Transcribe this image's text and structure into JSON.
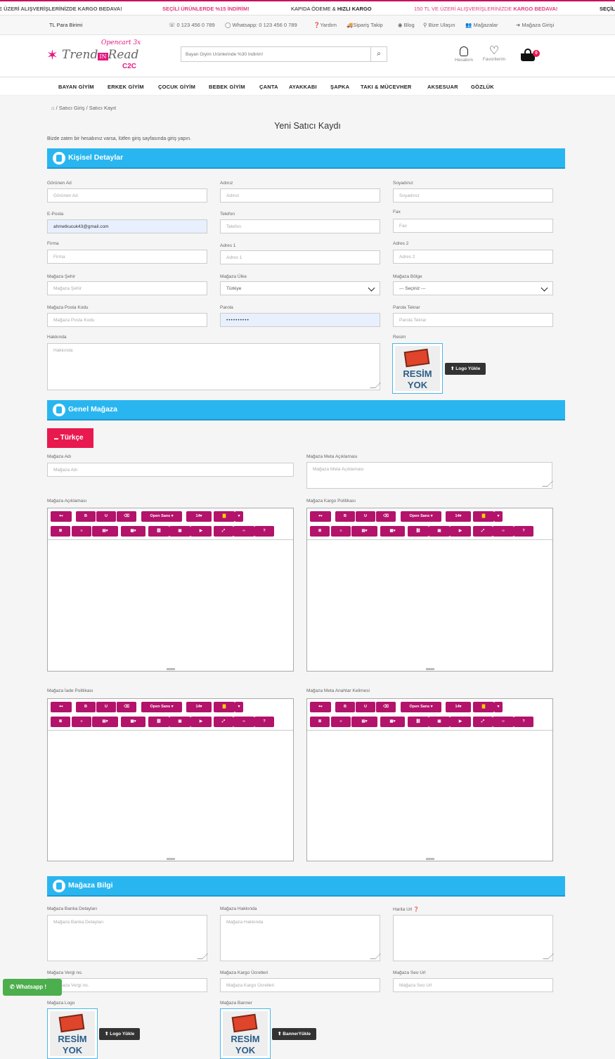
{
  "announcements": [
    {
      "pre": "E ÜZERİ ALIŞVERİŞLERİNİZDE ",
      "hl": "KARGO BEDAVA!",
      "color": "dark"
    },
    {
      "pre": "SEÇİLİ ÜRÜNLERDE ",
      "hl": "%15 İNDİRİM!",
      "color": "pink"
    },
    {
      "pre": "KAPIDA ÖDEME & ",
      "hl": "HIZLI KARGO",
      "color": "dark"
    },
    {
      "pre": "150 TL VE ÜZERİ ALIŞVERİŞLERİNİZDE ",
      "hl": "KARGO BEDAVA!",
      "color": "pink"
    },
    {
      "pre": "SEÇİL",
      "hl": "",
      "color": "dark"
    }
  ],
  "util": {
    "currency": "TL Para Birimi",
    "phone": "0 123 456 0 789",
    "whatsapp": "Whatsapp: 0 123 456 0 789",
    "help": "Yardım",
    "order_track": "Sipariş Takip",
    "blog": "Blog",
    "contact": "Bize Ulaşın",
    "stores": "Mağazalar",
    "store_login": "Mağaza Girişi"
  },
  "logo": {
    "top": "Opencart 3x",
    "main": "Trend",
    "badge": "IN",
    "main2": "Read",
    "sub": "C2C"
  },
  "search": {
    "placeholder": "Bayan Giyim Ürünlerinde %30 İndirim!"
  },
  "header_icons": {
    "account": "Hesabım",
    "favorites": "Favorilerim",
    "cart_count": "0"
  },
  "nav": [
    "BAYAN GİYİM",
    "ERKEK GİYİM",
    "ÇOCUK GİYİM",
    "BEBEK GİYİM",
    "ÇANTA",
    "AYAKKABI",
    "ŞAPKA",
    "TAKI & MÜCEVHER",
    "AKSESUAR",
    "GÖZLÜK"
  ],
  "breadcrumb": [
    "Satıcı Giriş",
    "Satıcı Kayıt"
  ],
  "page_title": "Yeni Satıcı Kaydı",
  "login_note": "Bizde zaten bir hesabınız varsa, lütfen giriş sayfasında giriş yapın.",
  "sections": {
    "personal": "Kişisel Detaylar",
    "general": "Genel Mağaza",
    "info": "Mağaza Bilgi"
  },
  "personal": {
    "display_name": {
      "label": "Görünen Ad",
      "placeholder": "Görünen Ad"
    },
    "first_name": {
      "label": "Adınız",
      "placeholder": "Adınız"
    },
    "last_name": {
      "label": "Soyadınız",
      "placeholder": "Soyadınız"
    },
    "email": {
      "label": "E-Posta",
      "value": "ahmetkucuk43@gmail.com"
    },
    "phone": {
      "label": "Telefon",
      "placeholder": "Telefon"
    },
    "fax": {
      "label": "Fax",
      "placeholder": "Fax"
    },
    "company": {
      "label": "Firma",
      "placeholder": "Firma"
    },
    "address1": {
      "label": "Adres 1",
      "placeholder": "Adres 1"
    },
    "address2": {
      "label": "Adres 2",
      "placeholder": "Adres 2"
    },
    "city": {
      "label": "Mağaza Şehir",
      "placeholder": "Mağaza Şehir"
    },
    "country": {
      "label": "Mağaza Ülke",
      "value": "Türkiye"
    },
    "region": {
      "label": "Mağaza Bölge",
      "value": "--- Seçiniz ---"
    },
    "postcode": {
      "label": "Mağaza Posta Kodu",
      "placeholder": "Mağaza Posta Kodu"
    },
    "password": {
      "label": "Parola",
      "value": "••••••••••"
    },
    "password_confirm": {
      "label": "Parola Tekrar",
      "placeholder": "Parola Tekrar"
    },
    "about": {
      "label": "Hakkında",
      "placeholder": "Hakkında"
    },
    "image": {
      "label": "Resim",
      "button": "Logo Yükle"
    }
  },
  "no_image": {
    "line1": "RESİM",
    "line2": "YOK"
  },
  "general": {
    "language_tab": "Türkçe",
    "store_name": {
      "label": "Mağaza Adı",
      "placeholder": "Mağaza Adı"
    },
    "meta_desc": {
      "label": "Mağaza Meta Açıklaması",
      "placeholder": "Mağaza Meta Açıklaması"
    },
    "desc_label": "Mağaza Açıklaması",
    "shipping_label": "Mağaza Kargo Politikası",
    "return_label": "Mağaza İade Politikası",
    "meta_keywords_label": "Mağaza Meta Anahtar Kelimesi"
  },
  "editor_toolbar": {
    "font": "Open Sans ▾",
    "size": "14▾"
  },
  "info": {
    "bank": {
      "label": "Mağaza Banka Detayları",
      "placeholder": "Mağaza Banka Detayları"
    },
    "about": {
      "label": "Mağaza Hakkında",
      "placeholder": "Mağaza Hakkında"
    },
    "map": {
      "label": "Harita Url"
    },
    "tax": {
      "label": "Mağaza Vergi no.",
      "placeholder": "Mağaza Vergi no."
    },
    "shipping_fee": {
      "label": "Mağaza Kargo Ücretleri",
      "placeholder": "Mağaza Kargo Ücretleri"
    },
    "seo": {
      "label": "Mağaza Seo Url",
      "placeholder": "Mağaza Seo Url"
    },
    "logo": {
      "label": "Mağaza Logo",
      "button": "Logo Yükle"
    },
    "banner": {
      "label": "Mağaza Banner",
      "button": "BannerYükle"
    }
  },
  "whatsapp_btn": "Whatsapp !",
  "colors": {
    "accent": "#29b6f0",
    "brand": "#b3136a",
    "tab": "#e8194f",
    "whatsapp": "#4cae4c"
  }
}
